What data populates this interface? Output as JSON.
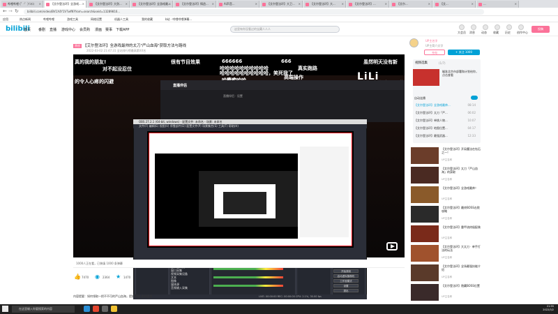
{
  "browser_tabs": [
    {
      "label": "哔哩哔哩 (゜-゜)つロ"
    },
    {
      "label": "【艾尔登法环】全游戏..."
    },
    {
      "label": "【艾尔登法环】大剑..."
    },
    {
      "label": "【艾尔登法环】全游戏最..."
    },
    {
      "label": "【艾尔登法环】铸造..."
    },
    {
      "label": "Ai声音..."
    },
    {
      "label": "【艾尔登法环】大卫..."
    },
    {
      "label": "【艾尔登法环】大..."
    },
    {
      "label": "【艾尔登法环】..."
    },
    {
      "label": "【艾尔..."
    },
    {
      "label": "【艾..."
    },
    {
      "label": "..."
    }
  ],
  "address": {
    "url": "bilibili.com/video/BV1X4Y1V7wfN?from=search&seid=13289816..."
  },
  "bookmarks": [
    "应用",
    "热点新闻",
    "哔哩哔哩",
    "游戏工具",
    "网络设置",
    "机器人工具",
    "我的收藏",
    "b站 · 哔哩哔哩弹幕..."
  ],
  "nav": {
    "logo": "bilibili",
    "items": [
      "首页",
      "番剧",
      "直播",
      "游戏中心",
      "会员购",
      "漫画",
      "赛事",
      "下载APP"
    ],
    "search_placeholder": "这里有你没看过的宝藏人人人",
    "user_items": [
      "大会员",
      "消息",
      "动态",
      "收藏",
      "历史",
      "创作中心"
    ],
    "upload": "投稿"
  },
  "video": {
    "tag": "原创",
    "title": "【艾尔登法环】全游戏最帅的太刀\"严山血海\"获取方法与路线",
    "meta": "2022-03-02 21:47:31  全站排行榜最高第XX名",
    "danmaku": [
      "真的我的朋友!",
      "对不起没忍住",
      "的令人心疼的闪避",
      "很有节目效果",
      "666666",
      "666",
      "哈哈哈哈哈哈哈哈哈哈",
      "哈哈哈哈哈哈哈哈哈哈，笑死我了",
      "真实跑路",
      "虽然明天没有新",
      "有点听不懂",
      "哈哈哈哈哈",
      "真实",
      "高端操作"
    ],
    "watermark": "LiLi",
    "below_text": "1000人正在看，已装填 1000 条弹幕",
    "stats": {
      "likes": "7470",
      "coins": "2364",
      "favs": "1470",
      "share": "分享"
    },
    "desc": "内容提要：如何领取一把不不可的严山血海，提前用好 此时此刻"
  },
  "uploader": {
    "name": "UP主名字",
    "sub": "UP主简介文字",
    "charge": "充电",
    "follow": "+ 关注 1000"
  },
  "playlist": {
    "header": "视频选集",
    "count": "(1/7)",
    "ad_text": "瞄准北京市部署和计划给你，点击查看",
    "autoplay": "自动连播",
    "items": [
      {
        "title": "【艾尔登法环】全游戏最帅...",
        "dur": "08:14"
      },
      {
        "title": "【艾尔登法环】太刀「严...",
        "dur": "06:02"
      },
      {
        "title": "【艾尔登法环】单挑人物...",
        "dur": "10:07"
      },
      {
        "title": "【艾尔登法环】地图位置...",
        "dur": "04:17"
      },
      {
        "title": "【艾尔登法环】最强武器...",
        "dur": "12:33"
      }
    ]
  },
  "recommend": [
    {
      "title": "【艾尔登法环】开局魔法在钻石之一！",
      "up": "UP主名称"
    },
    {
      "title": "【艾尔登法环】太刀「严山血海」的获取",
      "up": "UP主名称"
    },
    {
      "title": "【艾尔登法环】全游戏最帅！",
      "up": "UP主名称"
    },
    {
      "title": "【艾尔登法环】最终BOSS击败攻略",
      "up": "UP主名称"
    },
    {
      "title": "【艾尔登法环】重甲流终极配装",
      "up": "UP主名称"
    },
    {
      "title": "【艾尔登法环】大太刀 · 单手打法的玩法",
      "up": "UP主名称"
    },
    {
      "title": "【艾尔登法环】全场最强技能介绍",
      "up": "UP主名称"
    },
    {
      "title": "【艾尔登法环】隐藏BOSS位置",
      "up": "UP主名称"
    }
  ],
  "obs": {
    "title": "OBS 27.2.1 (64-bit, windows) - 配置文件: 未命名 - 场景: 未命名",
    "menu": "文件(F)  编辑(E)  视图(V)  停靠部件(D)  配置文件(P)  场景集合(S)  工具(T)  帮助(H)",
    "docks": [
      "场景",
      "来源",
      "混音器",
      "转场特效",
      "控制"
    ],
    "sources": [
      "显示器采集",
      "窗口采集",
      "视频采集设备",
      "文本",
      "图像",
      "媒体源",
      "音频输入采集"
    ],
    "buttons": [
      "开始推流",
      "开始录制",
      "启动虚拟摄像机",
      "工作室模式",
      "设置",
      "退出"
    ],
    "status": "LIVE: 00:00:00  REC: 00:00:00  CPU: 2.1%, 30.00 fps"
  },
  "bg_window": {
    "title": "直播伴侣",
    "line": "直播伴侣 · 设置"
  },
  "taskbar": {
    "search": "在这里输入你要搜索的内容",
    "time": "21:55",
    "date": "2022/3/2"
  }
}
